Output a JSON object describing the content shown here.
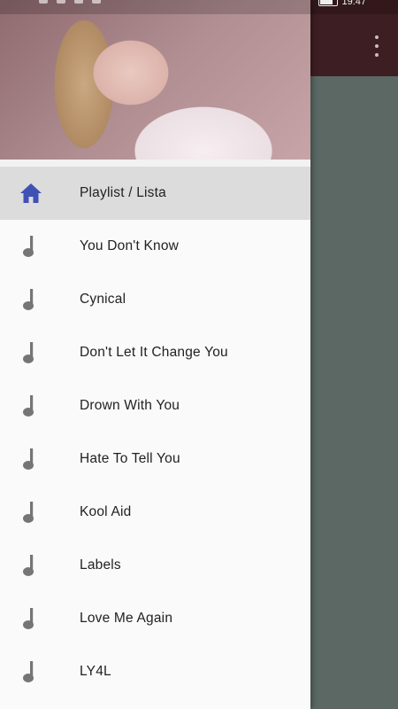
{
  "colors": {
    "drawer_bg": "#fafafa",
    "selected_bg": "#dcdcdc",
    "home_icon": "#3f51b5",
    "note_icon": "#757575",
    "toolbar": "#3d1e22",
    "content": "#5b6864"
  },
  "status_bar": {
    "time": "19:47"
  },
  "header": {
    "image": "header-photo"
  },
  "menu": {
    "items": [
      {
        "label": "Playlist / Lista",
        "icon": "home-icon",
        "selected": true
      },
      {
        "label": "You Don't Know",
        "icon": "music-note-icon"
      },
      {
        "label": "Cynical",
        "icon": "music-note-icon"
      },
      {
        "label": "Don't Let It Change You",
        "icon": "music-note-icon"
      },
      {
        "label": "Drown With You",
        "icon": "music-note-icon"
      },
      {
        "label": "Hate To Tell You",
        "icon": "music-note-icon"
      },
      {
        "label": "Kool Aid",
        "icon": "music-note-icon"
      },
      {
        "label": "Labels",
        "icon": "music-note-icon"
      },
      {
        "label": "Love Me Again",
        "icon": "music-note-icon"
      },
      {
        "label": "LY4L",
        "icon": "music-note-icon"
      }
    ]
  }
}
